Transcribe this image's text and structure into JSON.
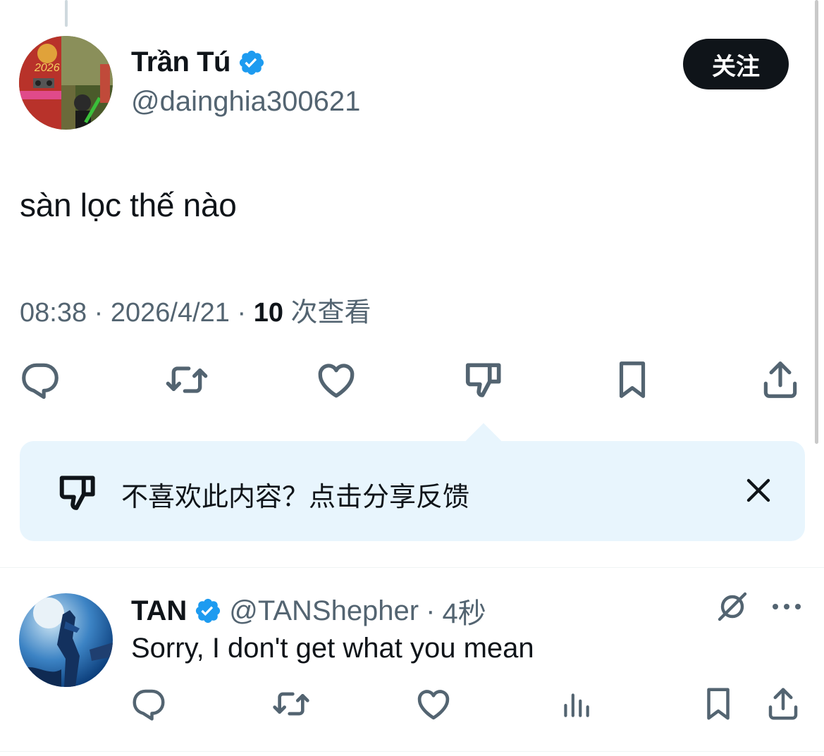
{
  "tweet": {
    "author_name": "Trần Tú",
    "author_handle": "@dainghia300621",
    "follow_label": "关注",
    "text": "sàn lọc thế nào",
    "time": "08:38",
    "separator": " · ",
    "date": "2026/4/21",
    "views_count": "10",
    "views_label": " 次查看",
    "avatar_caption": "2026",
    "actions": [
      "reply-icon",
      "retweet-icon",
      "like-icon",
      "dislike-icon",
      "bookmark-icon",
      "share-icon"
    ]
  },
  "feedback": {
    "text": "不喜欢此内容？点击分享反馈",
    "icon": "dislike-icon",
    "close_icon": "close-icon"
  },
  "reply": {
    "author_name": "TAN",
    "author_handle": "@TANShepher",
    "age": "4秒",
    "text": "Sorry, I don't get what you mean",
    "actions": [
      "reply-icon",
      "retweet-icon",
      "like-icon",
      "views-icon",
      "bookmark-icon",
      "share-icon"
    ],
    "header_icons": [
      "grok-icon",
      "more-icon"
    ]
  },
  "colors": {
    "verified": "#1d9bf0",
    "secondary_text": "#536471",
    "feedback_bg": "#e8f5fd",
    "button_bg": "#0f1419"
  }
}
